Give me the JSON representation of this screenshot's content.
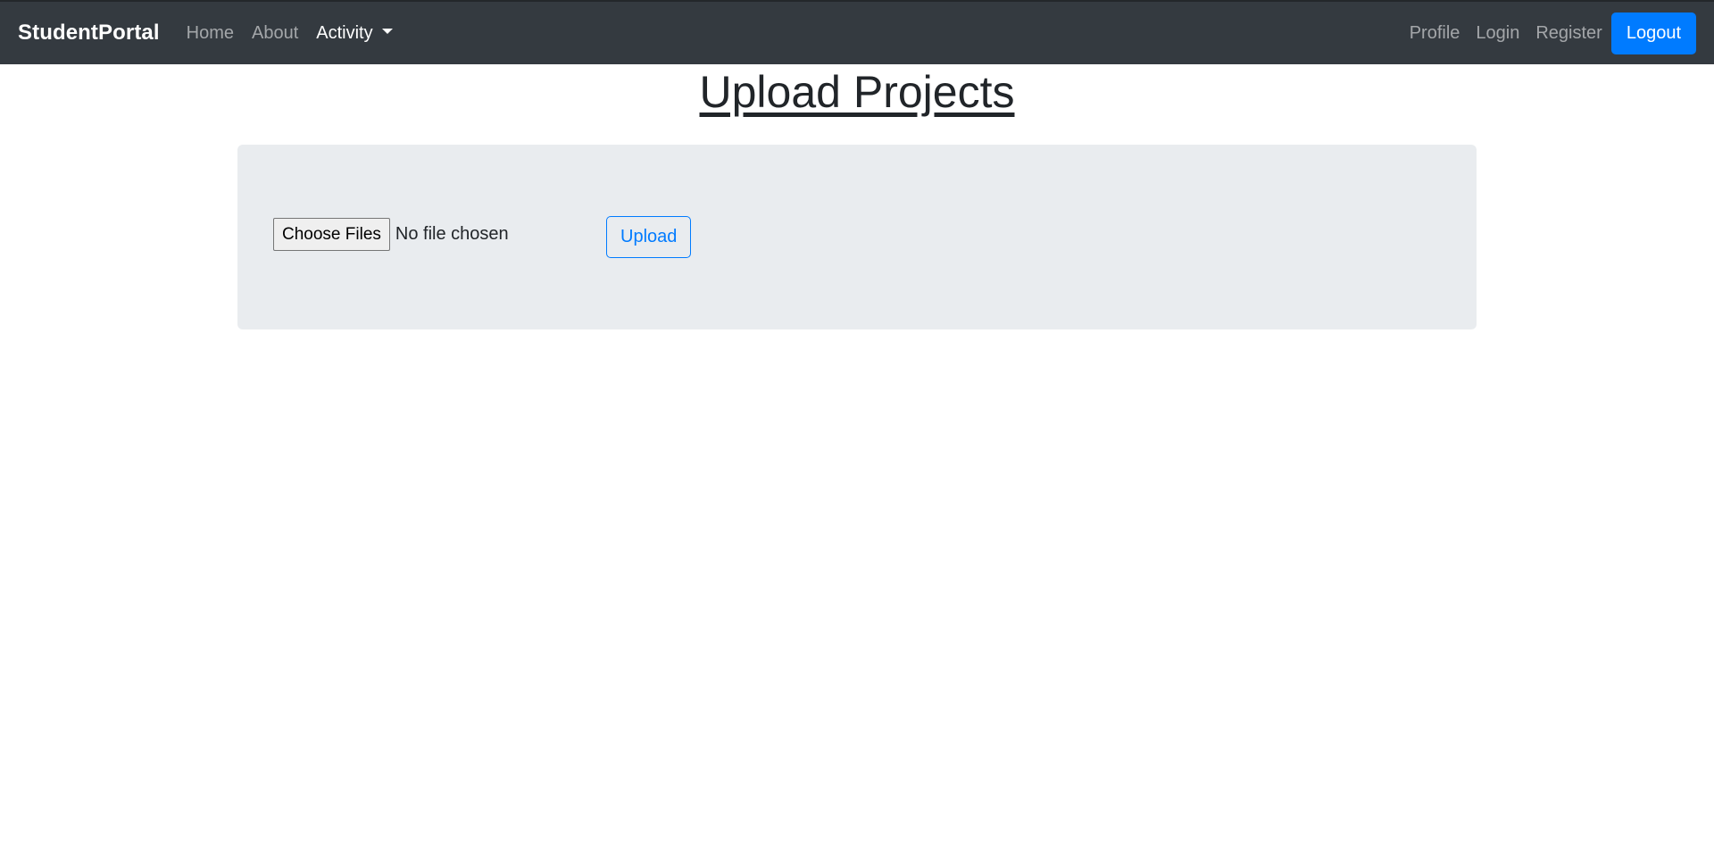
{
  "navbar": {
    "brand": "StudentPortal",
    "left_links": [
      {
        "label": "Home"
      },
      {
        "label": "About"
      },
      {
        "label": "Activity"
      }
    ],
    "right_links": [
      {
        "label": "Profile"
      },
      {
        "label": "Login"
      },
      {
        "label": "Register"
      }
    ],
    "logout_label": "Logout"
  },
  "page": {
    "title": "Upload Projects"
  },
  "upload_form": {
    "choose_label": "Choose Files",
    "file_status": "No file chosen",
    "upload_label": "Upload"
  },
  "colors": {
    "navbar_bg": "#343a40",
    "primary": "#007bff",
    "panel_bg": "#e9ecef"
  }
}
